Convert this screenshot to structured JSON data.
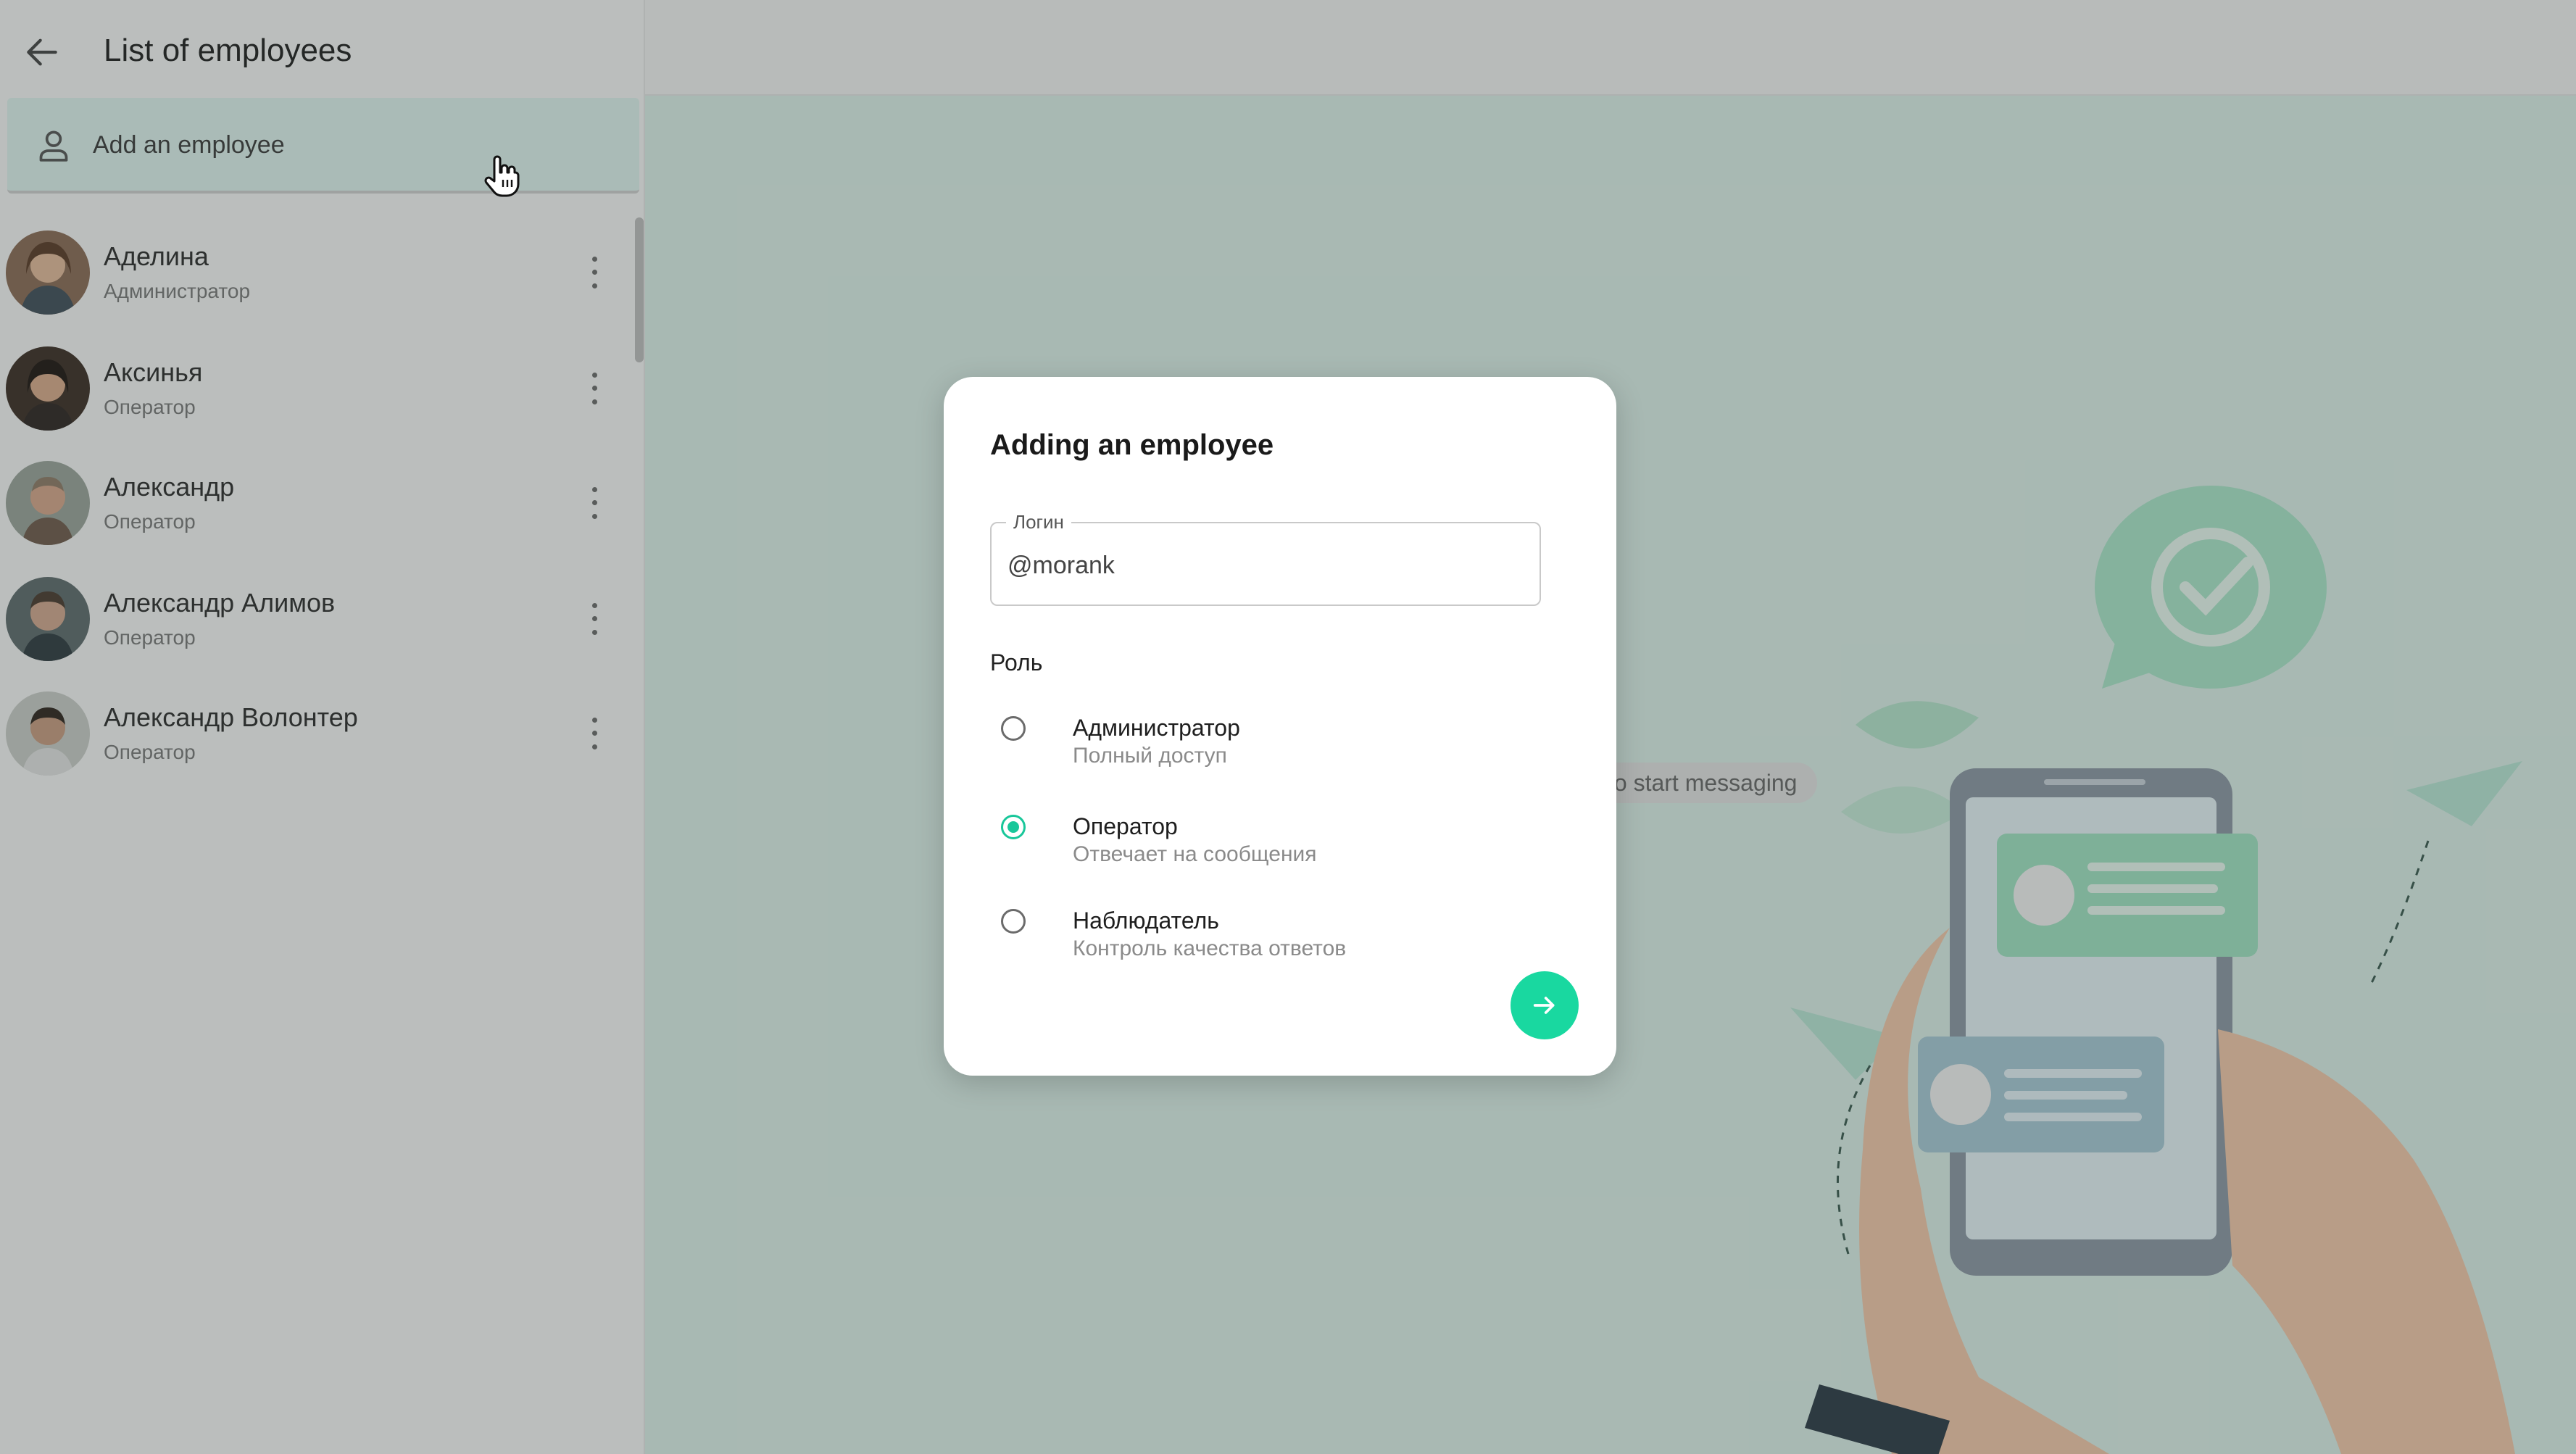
{
  "sidebar": {
    "title": "List of employees",
    "add_employee_label": "Add an employee",
    "employees": [
      {
        "name": "Аделина",
        "role": "Администратор"
      },
      {
        "name": "Аксинья",
        "role": "Оператор"
      },
      {
        "name": "Александр",
        "role": "Оператор"
      },
      {
        "name": "Александр Алимов",
        "role": "Оператор"
      },
      {
        "name": "Александр Волонтер",
        "role": "Оператор"
      }
    ]
  },
  "main": {
    "hint_text": "to start messaging"
  },
  "modal": {
    "title": "Adding an employee",
    "login_label": "Логин",
    "login_value": "@morank",
    "role_heading": "Роль",
    "roles": [
      {
        "title": "Администратор",
        "subtitle": "Полный доступ",
        "selected": false
      },
      {
        "title": "Оператор",
        "subtitle": "Отвечает на сообщения",
        "selected": true
      },
      {
        "title": "Наблюдатель",
        "subtitle": "Контроль качества ответов",
        "selected": false
      }
    ]
  },
  "colors": {
    "accent": "#19d8a0",
    "radio_selected": "#19c79a",
    "add_row_bg": "#dff3ee",
    "chat_bg": "#dcefe9"
  },
  "icons": {
    "back": "arrow-left-icon",
    "add_employee": "person-icon",
    "more": "more-vertical-icon",
    "submit": "arrow-right-icon",
    "cursor": "hand-pointer-icon"
  }
}
